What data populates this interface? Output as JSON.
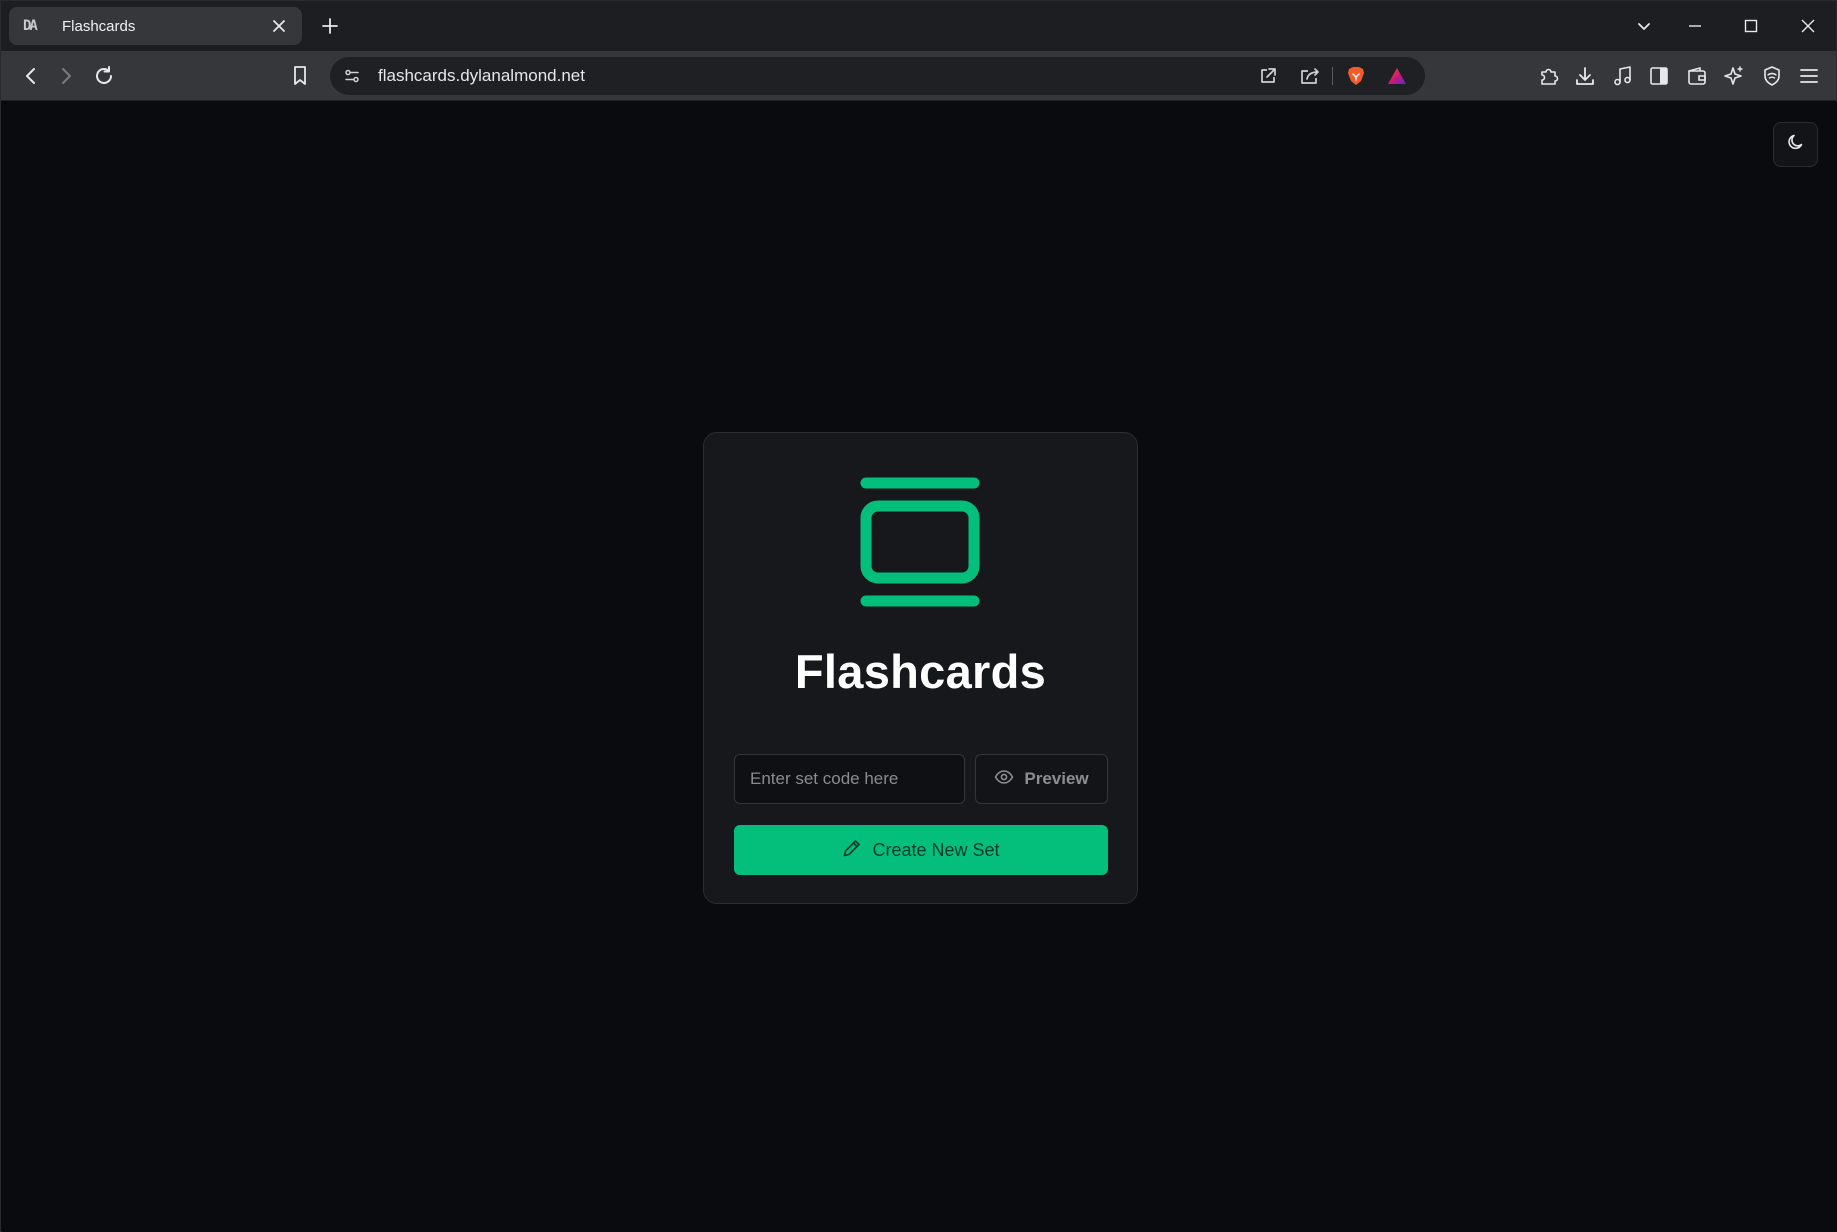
{
  "browser": {
    "tab": {
      "favicon_text": "DA",
      "title": "Flashcards"
    },
    "url": "flashcards.dylanalmond.net",
    "icons": {
      "close": "close-icon",
      "new_tab": "plus-icon",
      "back": "back-arrow-icon",
      "forward": "forward-arrow-icon",
      "reload": "reload-icon",
      "bookmark": "bookmark-icon",
      "site_info": "site-settings-icon",
      "open_external": "open-external-icon",
      "share": "share-icon",
      "brave_shields": "brave-lion-icon",
      "rewards": "triangle-rewards-icon",
      "extensions": "puzzle-icon",
      "downloads": "download-icon",
      "media": "music-note-icon",
      "sidebar": "sidebar-icon",
      "wallet": "wallet-icon",
      "leo": "sparkle-icon",
      "vpn": "shield-icon",
      "menu": "hamburger-menu-icon"
    }
  },
  "page": {
    "app_title": "Flashcards",
    "set_code_placeholder": "Enter set code here",
    "preview_label": "Preview",
    "create_label": "Create New Set",
    "theme_toggle_icon": "moon-icon",
    "colors": {
      "accent": "#04bf7c",
      "background": "#0a0b0e",
      "card": "#17181b"
    }
  }
}
